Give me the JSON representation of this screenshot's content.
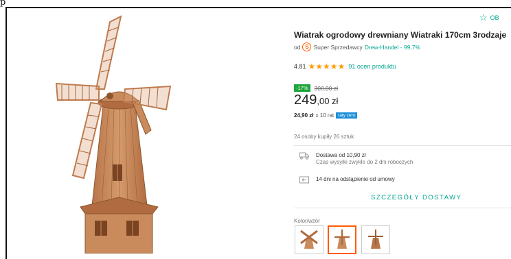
{
  "page": {
    "corner_glyph": "p",
    "observe_label": "OB"
  },
  "product": {
    "title": "Wiatrak ogrodowy drewniany Wiatraki 170cm 3rodzaje",
    "seller_prefix": "od",
    "seller_badge_letter": "S",
    "seller_program": "Super Sprzedawcy",
    "shop_name": "Drew-Handel - 99,7%",
    "rating_value": "4.81",
    "rating_stars": "★★★★★",
    "reviews_count": "91 ocen produktu",
    "discount_badge": "-17%",
    "old_price": "300,00 zł",
    "price_main": "249",
    "price_cents": ",00 zł",
    "installment_amount": "24,90 zł",
    "installment_count": "x 10 rat",
    "installment_badge": "raty zero",
    "bought_info": "24 osoby kupiły 26 sztuk"
  },
  "delivery": {
    "shipping_title": "Dostawa od 10,90 zł",
    "shipping_sub": "Czas wysyłki zwykle do 2 dni roboczych",
    "returns": "14 dni na odstąpienie od umowy",
    "details_link": "SZCZEGÓŁY DOSTAWY"
  },
  "variants": {
    "label": "Kolor/wzór",
    "selected_index": 1,
    "count": 3
  },
  "colors": {
    "accent": "#00a790",
    "brand_orange": "#ff5a00",
    "star": "#ff9c00",
    "discount": "#1ea53b",
    "installment_badge": "#1c8fd8",
    "wood": "#c98a5c"
  },
  "icons": {
    "observe": "star-outline-icon",
    "shipping": "truck-icon",
    "returns": "return-box-icon",
    "seller_badge": "super-seller-icon"
  }
}
